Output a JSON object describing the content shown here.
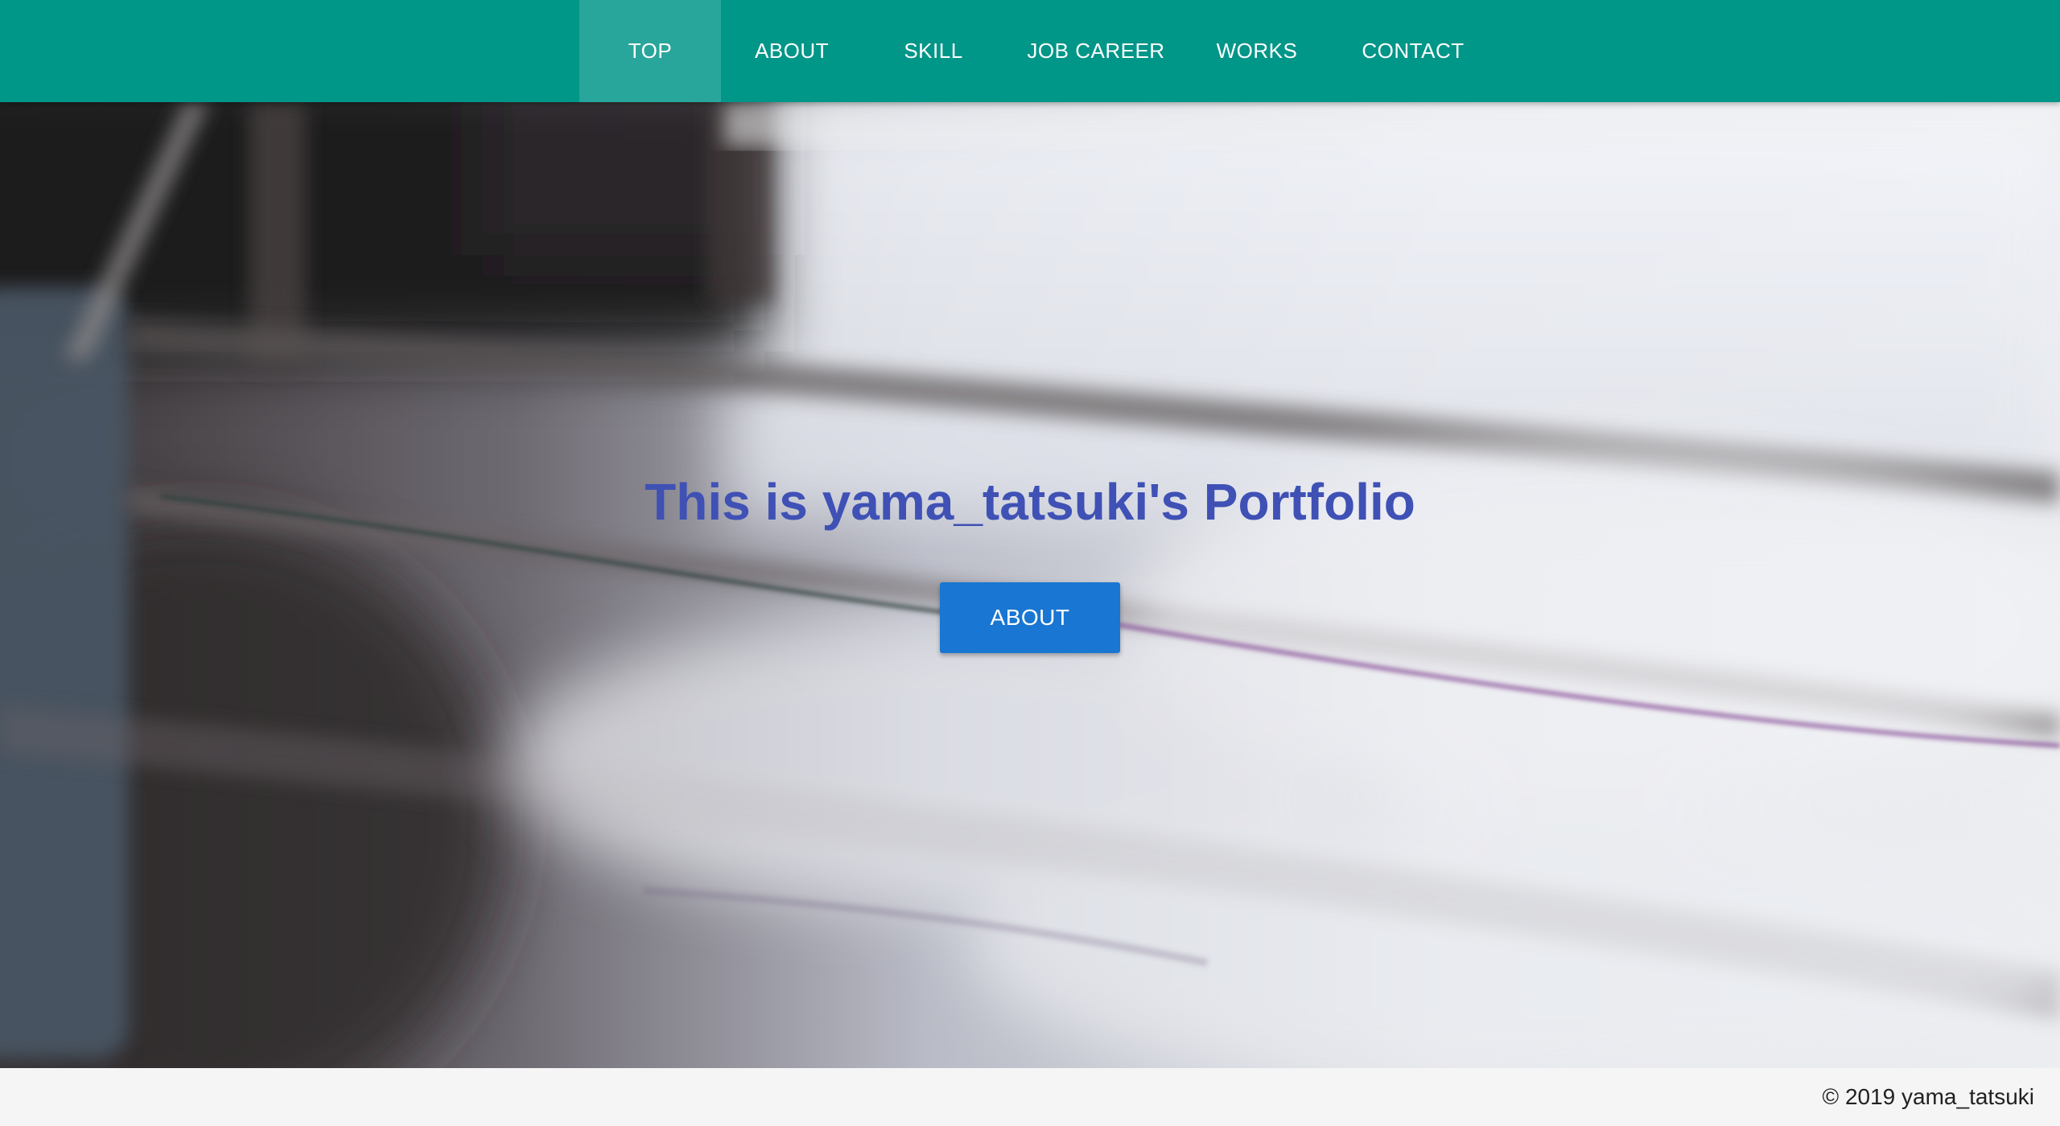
{
  "nav": {
    "items": [
      {
        "label": "TOP",
        "active": true
      },
      {
        "label": "ABOUT",
        "active": false
      },
      {
        "label": "SKILL",
        "active": false
      },
      {
        "label": "JOB CAREER",
        "active": false
      },
      {
        "label": "WORKS",
        "active": false
      },
      {
        "label": "CONTACT",
        "active": false
      }
    ]
  },
  "hero": {
    "title": "This is yama_tatsuki's Portfolio",
    "button_label": "ABOUT",
    "background": "blurred-wooden-table-photo"
  },
  "footer": {
    "copyright": "© 2019 yama_tatsuki"
  },
  "colors": {
    "header": "#009688",
    "title": "#3f51b5",
    "button": "#1976d2",
    "footer": "#f5f5f5"
  }
}
